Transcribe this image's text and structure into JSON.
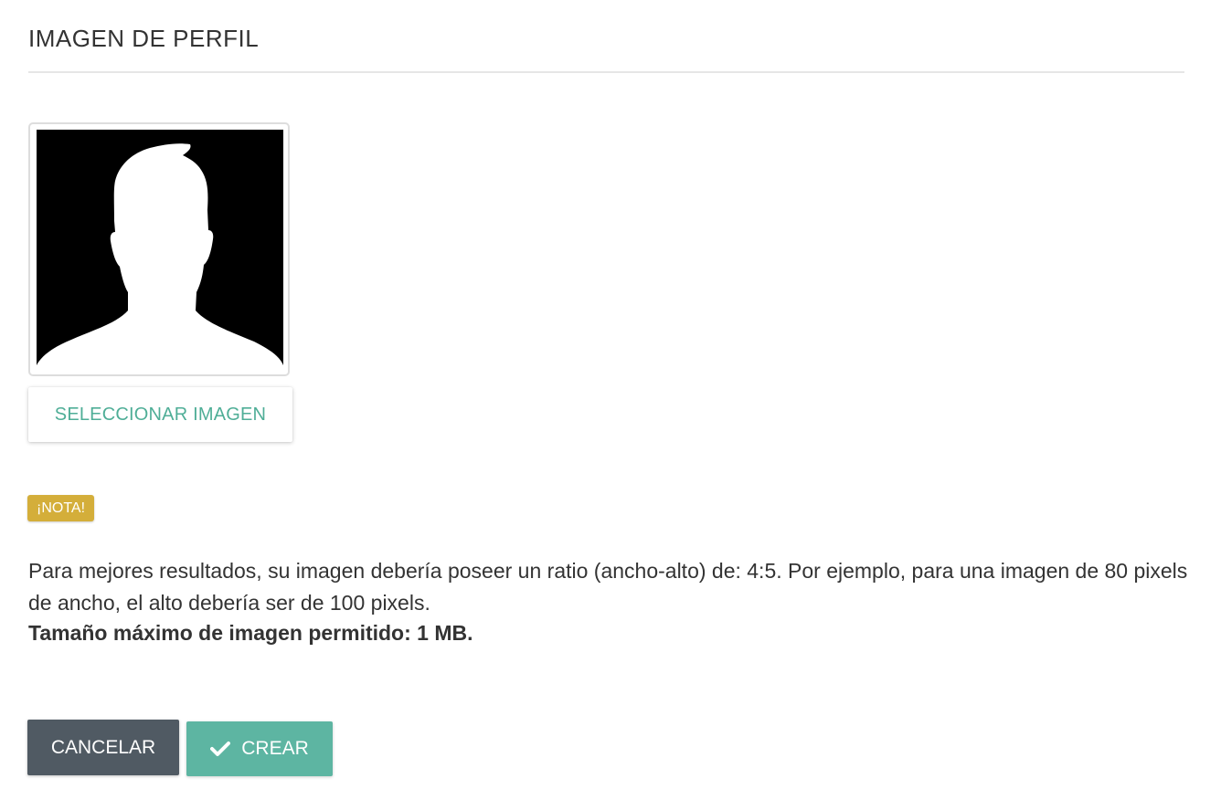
{
  "section": {
    "title": "IMAGEN DE PERFIL"
  },
  "avatar": {
    "icon": "person-silhouette-icon"
  },
  "select_button": {
    "label": "SELECCIONAR IMAGEN"
  },
  "note": {
    "badge": "¡NOTA!",
    "text": "Para mejores resultados, su imagen debería poseer un ratio (ancho-alto) de: 4:5. Por ejemplo, para una imagen de 80 pixels de ancho, el alto debería ser de 100 pixels.",
    "bold_text": "Tamaño máximo de imagen permitido: 1 MB."
  },
  "actions": {
    "cancel_label": "CANCELAR",
    "create_label": "CREAR",
    "create_icon": "check-icon"
  },
  "colors": {
    "accent_teal": "#5db5a2",
    "select_text": "#4fae97",
    "cancel_bg": "#505a63",
    "badge_bg": "#d4ae3a"
  }
}
